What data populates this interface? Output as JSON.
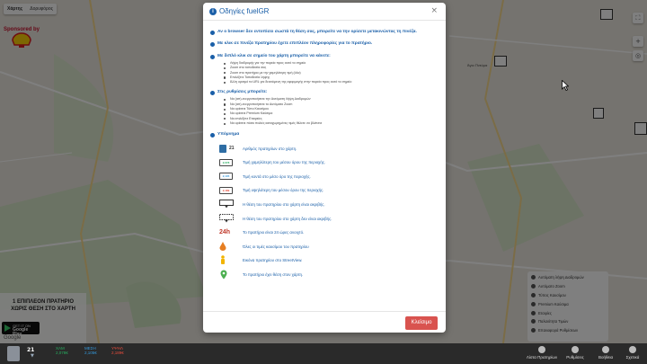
{
  "map": {
    "tabs": [
      "Χάρτης",
      "Δορυφόρος"
    ],
    "sponsor_label": "Sponsored by",
    "left_ad_line1": "1 ΕΠΙΠΛΕΟΝ ΠΡΑΤΗΡΙΟ",
    "left_ad_line2": "ΧΩΡΙΣ ΘΕΣΗ ΣΤΟ ΧΑΡΤΗ",
    "google_play_top": "GET IT ON",
    "google_play_label": "Google Play",
    "google_logo": "Google",
    "map_place_label": "Άγιο Πνεύμα"
  },
  "side_menu": {
    "items": [
      "Αυτόματη λήψη Διαδρομών",
      "Αυτόματο Zoom",
      "Τύπος Καυσίμου",
      "Premium Καύσιμα",
      "Εταιρίες",
      "Παλαιότητα Τιμών",
      "Επαναφορά Ρυθμίσεων"
    ]
  },
  "bottom_bar": {
    "count": "21",
    "prices": [
      {
        "label": "ΧΑΜ",
        "value": "2,078€",
        "color": "#27ae60"
      },
      {
        "label": "ΜΕΣΗ",
        "value": "2,105€",
        "color": "#3498db"
      },
      {
        "label": "ΥΨΗΛ",
        "value": "2,189€",
        "color": "#e74c3c"
      }
    ],
    "right_items": [
      "Λίστα Πρατηρίων",
      "Ρυθμίσεις",
      "Βοήθεια",
      "Σχετικά"
    ]
  },
  "modal": {
    "title": "Οδηγίες fuelGR",
    "close_symbol": "×",
    "close_button": "Κλείσιμο",
    "sections": [
      {
        "text": "Αν ο browser δεν εντοπίσει σωστά τη θέση σας, μπορείτε να την ορίσετε μετακινώντας τη πινέζα.",
        "items": []
      },
      {
        "text": "Με κλικ σε πινέζα πρατηρίου έχετε επιπλέον πληροφορίες για το πρατήριο.",
        "items": []
      },
      {
        "text": "Με διπλό κλικ σε σημείο του χάρτη μπορείτε να κάνετε:",
        "items": [
          "Λήψη διαδρομής για την πορεία προς αυτό το σημείο",
          "Zoom στο τοποθεσία σας",
          "Zoom στο πρατήριο με την χαμηλότερη τιμή (όλα)",
          "Επιλέξετε Τοποθεσία λήψης",
          "Άλλη ορισμό τα URL για δεικτόμενη της εφαρμογής στην πορεία προς αυτό το σημείο"
        ]
      },
      {
        "text": "Στις ρυθμίσεις μπορείτε:",
        "items": [
          "Να (απ)-ενεργοποιήσετε την Αυτόματη Λήψη Διαδρομών",
          "Να (απ)-ενεργοποιήσετε το Αυτόματο Zoom",
          "Να ορίσετε Τύπο Καυσίμου",
          "Να ορίσετε Premium Καύσιμα",
          "Να επιλέξετε Εταιρείες",
          "Να ορίσετε πόσο παλιές καταχωρημένες τιμές θέλετε να βλέπετε"
        ]
      },
      {
        "text": "Υπόμνημα",
        "items": []
      }
    ],
    "legend": [
      {
        "icon": "count",
        "icon_text": "21",
        "text": "Αριθμός πρατηρίων στο χάρτη."
      },
      {
        "icon": "box",
        "icon_text": "2,078",
        "icon_color": "#27ae60",
        "text": "Τιμή χαμηλότερη του μέσου όρου της περιοχής."
      },
      {
        "icon": "box",
        "icon_text": "2,105",
        "icon_color": "#3498db",
        "text": "Τιμή κοντά στο μέσο όρο της περιοχής."
      },
      {
        "icon": "box",
        "icon_text": "2,189",
        "icon_color": "#e74c3c",
        "text": "Τιμή υψηλότερη του μέσου όρου της περιοχής."
      },
      {
        "icon": "pin-box",
        "icon_text": "",
        "text": "Η θέση του πρατηρίου στο χάρτη είναι ακριβής."
      },
      {
        "icon": "pin-box",
        "icon_text": "",
        "text": "Η θέση του πρατηρίου στο χάρτη δεν είναι ακριβής."
      },
      {
        "icon": "h24",
        "icon_text": "24h",
        "text": "Το πρατήριο είναι 24 ώρες ανοιχτό."
      },
      {
        "icon": "drop",
        "icon_text": "",
        "text": "Όλες οι τιμές καυσίμου του πρατηρίου"
      },
      {
        "icon": "street",
        "icon_text": "",
        "text": "Εικόνα πρατηρίου στο StreetView."
      },
      {
        "icon": "nopin",
        "icon_text": "",
        "text": "Το πρατήριο έχει θέση στον χάρτη."
      }
    ]
  }
}
